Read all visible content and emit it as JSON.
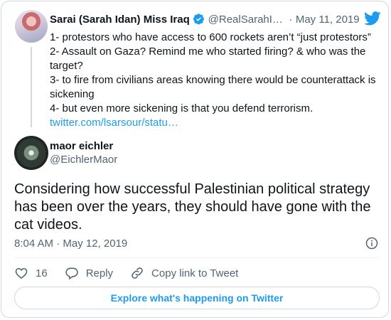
{
  "quoted": {
    "name": "Sarai (Sarah Idan) Miss Iraq",
    "handle": "@RealSarahI…",
    "separator": "·",
    "date": "May 11, 2019",
    "lines": [
      "1- protestors who have access to 600 rockets aren’t “just protestors”",
      "2- Assault on Gaza? Remind me who started firing? & who was the target?",
      "3- to fire from civilians areas knowing there would be counterattack is sickening",
      "4- but even more sickening is that you defend terrorism."
    ],
    "link": "twitter.com/lsarsour/statu…"
  },
  "tweet": {
    "name": "maor eichler",
    "handle": "@EichlerMaor",
    "text": "Considering how successful Palestinian political strategy has been over the years, they should have gone with the cat videos.",
    "time": "8:04 AM · May 12, 2019"
  },
  "actions": {
    "likes": "16",
    "reply": "Reply",
    "copy": "Copy link to Tweet"
  },
  "explore": "Explore what's happening on Twitter",
  "colors": {
    "accent": "#1d9bf0",
    "text": "#0f1419",
    "secondary": "#536471",
    "border": "#cfd9de"
  }
}
